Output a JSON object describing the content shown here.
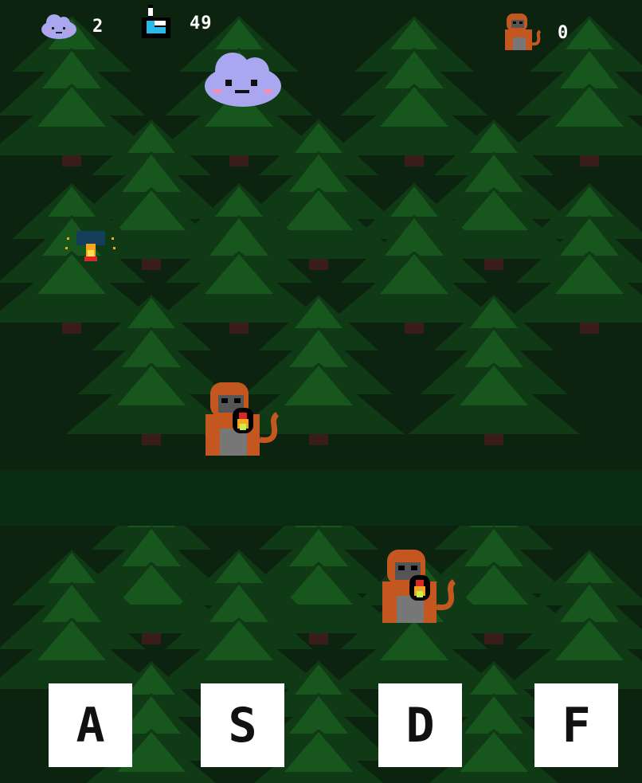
{
  "hud": {
    "lives": {
      "icon": "cloud-icon",
      "count": "2"
    },
    "timer": {
      "icon": "hourglass-icon",
      "count": "49"
    },
    "monkeys_caught": {
      "icon": "monkey-icon",
      "count": "0"
    }
  },
  "scene": {
    "player": {
      "icon": "cloud-icon"
    },
    "enemies": [
      {
        "type": "fire-monkey",
        "icon": "monkey-with-torch-icon"
      },
      {
        "type": "fire-monkey",
        "icon": "monkey-with-torch-icon"
      }
    ],
    "campfire": {
      "icon": "campfire-icon"
    }
  },
  "controls": {
    "keys": [
      "A",
      "S",
      "D",
      "F"
    ]
  },
  "colors": {
    "background": "#0c230f",
    "tree_dark": "#0f3a15",
    "tree_light": "#1f6d25",
    "cloud": "#a9a7f0",
    "monkey": "#c4561f",
    "key_bg": "#ffffff"
  }
}
